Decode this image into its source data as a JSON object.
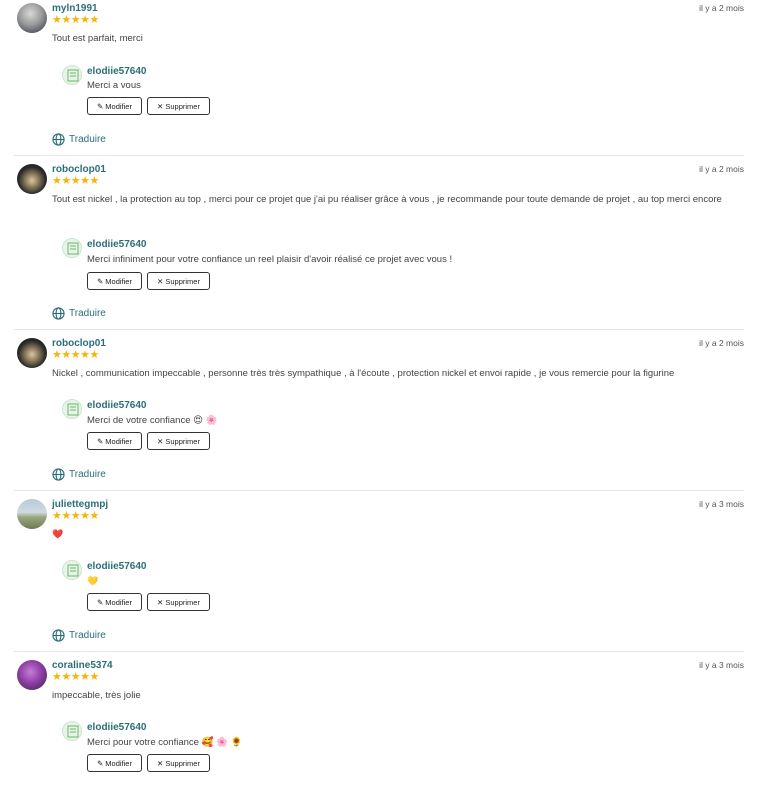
{
  "reviews": [
    {
      "username": "myln1991",
      "time": "il y a 2 mois",
      "stars": "★★★★★",
      "text": "Tout est parfait, merci",
      "reply": {
        "username": "elodiie57640",
        "text": "Merci a vous"
      },
      "translate": "Traduire"
    },
    {
      "username": "roboclop01",
      "time": "il y a 2 mois",
      "stars": "★★★★★",
      "text": "Tout est nickel , la protection au top , merci pour ce projet que j'ai pu réaliser grâce à vous , je recommande pour toute demande de projet , au top merci encore",
      "reply": {
        "username": "elodiie57640",
        "text": "Merci infiniment pour votre confiance un reel plaisir d'avoir réalisé ce projet avec vous !"
      },
      "translate": "Traduire"
    },
    {
      "username": "roboclop01",
      "time": "il y a 2 mois",
      "stars": "★★★★★",
      "text": "Nickel , communication impeccable , personne très très sympathique , à l'écoute , protection nickel et envoi rapide , je vous remercie pour la figurine",
      "reply": {
        "username": "elodiie57640",
        "text": "Merci de votre confiance 😍 🌸"
      },
      "translate": "Traduire"
    },
    {
      "username": "juliettegmpj",
      "time": "il y a 3 mois",
      "stars": "★★★★★",
      "text": "❤️",
      "reply": {
        "username": "elodiie57640",
        "text": "💛"
      },
      "translate": "Traduire"
    },
    {
      "username": "coraline5374",
      "time": "il y a 3 mois",
      "stars": "★★★★★",
      "text": "impeccable, très jolie",
      "reply": {
        "username": "elodiie57640",
        "text": "Merci pour votre confiance 🥰 🌸 🌻"
      },
      "translate": ""
    }
  ],
  "buttons": {
    "edit": "Modifier",
    "delete": "Supprimer"
  },
  "colors": {
    "accent": "#2a6f77",
    "star": "#f5b50a"
  }
}
